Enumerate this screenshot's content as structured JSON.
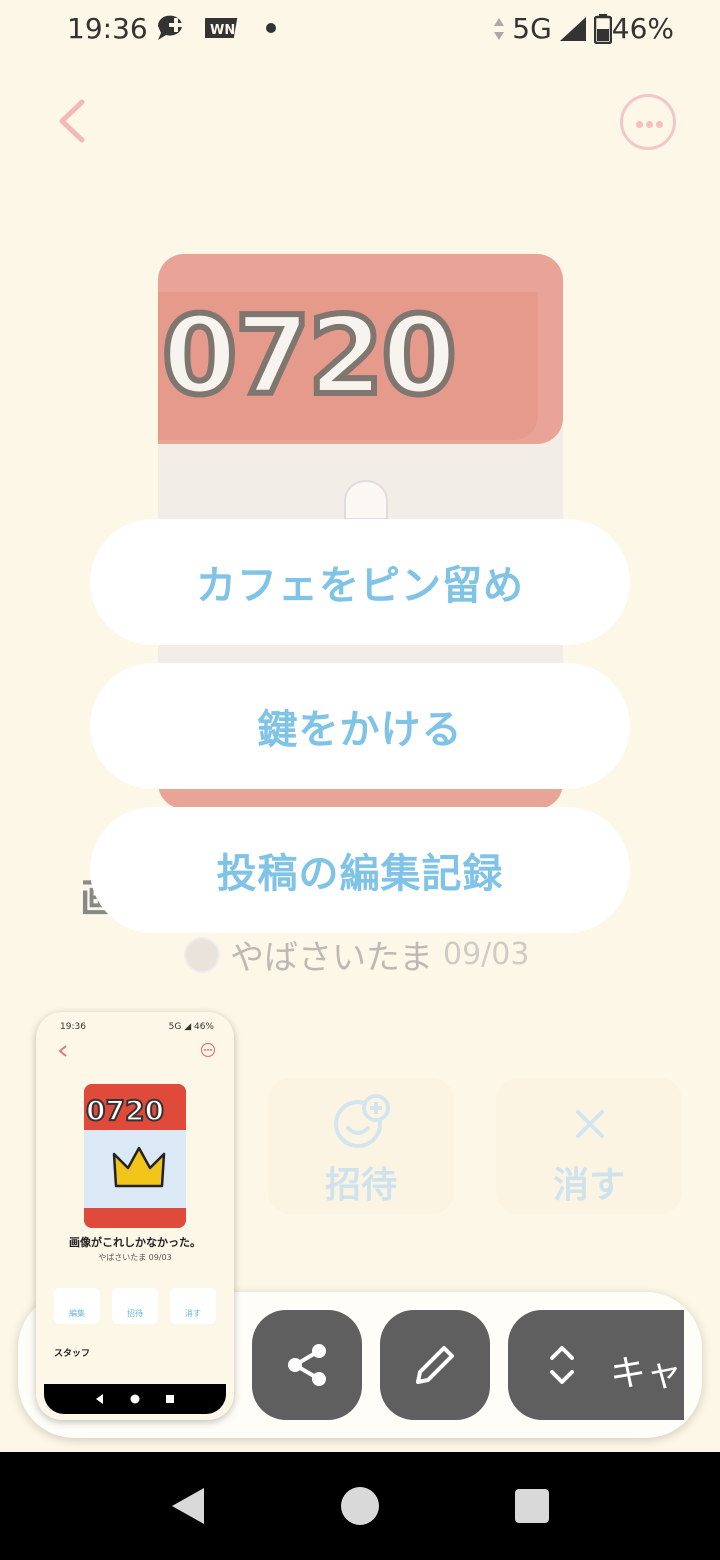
{
  "status_bar": {
    "time": "19:36",
    "network": "5G",
    "battery": "46%"
  },
  "post": {
    "image_text": "0720",
    "title_partial": "画",
    "author": "やばさいたま",
    "date": "09/03"
  },
  "actions": {
    "invite_label": "招待",
    "delete_label": "消す"
  },
  "menu": {
    "items": [
      {
        "label": "カフェをピン留め"
      },
      {
        "label": "鍵をかける"
      },
      {
        "label": "投稿の編集記録"
      }
    ]
  },
  "screenshot_toolbar": {
    "capture_label": "キャプ"
  },
  "thumbnail": {
    "status_time": "19:36",
    "status_right": "5G ◢ 46%",
    "image_text": "0720",
    "title": "画像がこれしかなかった。",
    "author": "やばさいたま 09/03",
    "edit_label": "編集",
    "invite_label": "招待",
    "delete_label": "消す",
    "section_label": "スタッフ"
  },
  "colors": {
    "background": "#fdf7e7",
    "menu_text": "#7fc3e6",
    "toolbar_button": "#5f5f5f"
  }
}
